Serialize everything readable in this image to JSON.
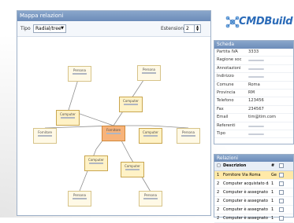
{
  "map": {
    "title": "Mappa relazioni",
    "type_label": "Tipo",
    "type_value": "Radial/tree",
    "extension_label": "Estensione",
    "extension_value": "2"
  },
  "nodes": {
    "center": "Fornitore",
    "pc_left": "Computer",
    "pc_top": "Computer",
    "pc_right": "Computer",
    "pc_bottom_left": "Computer",
    "pc_bottom": "Computer",
    "person_tl": "Persona",
    "person_tr": "Persona",
    "person_left": "Fornitore",
    "person_right": "Persona",
    "person_bl": "Persona",
    "person_br": "Persona"
  },
  "logo": {
    "text": "CMDBuild"
  },
  "card": {
    "title": "Scheda",
    "fields": [
      {
        "k": "Partita IVA",
        "v": "3333"
      },
      {
        "k": "Ragione soc",
        "v": ""
      },
      {
        "k": "Annotazioni",
        "v": ""
      },
      {
        "k": "Indirizzo",
        "v": ""
      },
      {
        "k": "Comune",
        "v": "Roma"
      },
      {
        "k": "Provincia",
        "v": "RM"
      },
      {
        "k": "Telefono",
        "v": "123456"
      },
      {
        "k": "Fax",
        "v": "234567"
      },
      {
        "k": "Email",
        "v": "tim@tim.com"
      },
      {
        "k": "Referenti",
        "v": ""
      },
      {
        "k": "Tipo",
        "v": ""
      }
    ]
  },
  "relations": {
    "title": "Relazioni",
    "headers": {
      "desc": "Descrizion",
      "num": "#"
    },
    "rows": [
      {
        "n": "1",
        "d": "Fornitore Via Roma",
        "q": "Ge"
      },
      {
        "n": "2",
        "d": "Computer acquistato da",
        "q": "1"
      },
      {
        "n": "2",
        "d": "Computer è assegnato",
        "q": "1"
      },
      {
        "n": "2",
        "d": "Computer è assegnato",
        "q": "1"
      },
      {
        "n": "2",
        "d": "Computer è assegnato",
        "q": "1"
      },
      {
        "n": "2",
        "d": "Computer è assegnato",
        "q": "1"
      }
    ]
  },
  "colors": {
    "header": "#7897c2",
    "node_fill": "#fff2c6",
    "center_fill": "#f7b37a",
    "logo_blue": "#2b6bb8",
    "edge": "#8e8e8e"
  }
}
